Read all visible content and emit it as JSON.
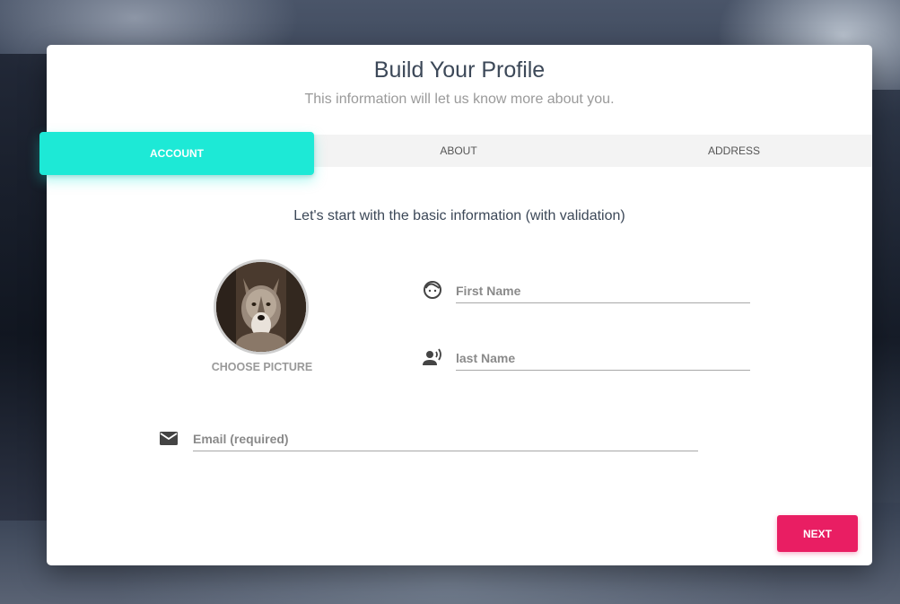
{
  "wizard": {
    "title": "Build Your Profile",
    "subtitle": "This information will let us know more about you."
  },
  "tabs": [
    {
      "label": "ACCOUNT",
      "active": true
    },
    {
      "label": "ABOUT",
      "active": false
    },
    {
      "label": "ADDRESS",
      "active": false
    }
  ],
  "account": {
    "intro": "Let's start with the basic information (with validation)",
    "choose_picture_label": "CHOOSE PICTURE",
    "avatar_icon": "wolf-photo",
    "first_name": {
      "placeholder": "First Name",
      "value": "",
      "icon": "face-icon"
    },
    "last_name": {
      "placeholder": "last Name",
      "value": "",
      "icon": "record-voice-icon"
    },
    "email": {
      "placeholder": "Email (required)",
      "value": "",
      "icon": "email-icon"
    }
  },
  "footer": {
    "next_label": "NEXT"
  },
  "colors": {
    "accent_tab": "#1de9d6",
    "next_button": "#e91e63",
    "title_text": "#3c4858"
  }
}
